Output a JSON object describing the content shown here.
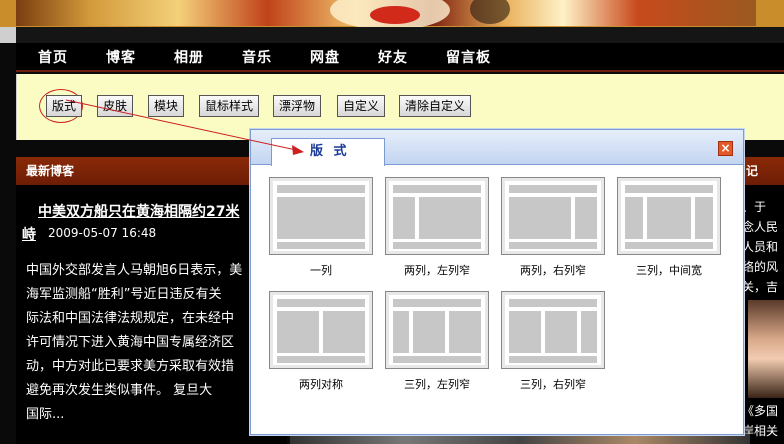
{
  "nav": {
    "items": [
      "首页",
      "博客",
      "相册",
      "音乐",
      "网盘",
      "好友",
      "留言板"
    ]
  },
  "toolbar": {
    "buttons": [
      "版式",
      "皮肤",
      "模块",
      "鼠标样式",
      "漂浮物",
      "自定义",
      "清除自定义"
    ]
  },
  "left_panel": {
    "heading": "最新博客",
    "post": {
      "title": "中美双方船只在黄海相隔约27米",
      "title_tail": "峙",
      "date": "2009-05-07 16:48",
      "body_lines": [
        "中国外交部发言人马朝旭6日表示，美",
        "海军监测船“胜利”号近日违反有关",
        "际法和中国法律法规规定，在未经中",
        "许可情况下进入黄海中国专属经济区",
        "动，中方对此已要求美方采取有效措",
        "避免再次发生类似事件。     复旦大",
        "国际..."
      ]
    }
  },
  "right_panel": {
    "heading": "记",
    "lines": [
      "、于",
      "念人民",
      "人员和",
      "络的风",
      "关，吉"
    ],
    "caption_lines": [
      "《多国",
      "岸相关"
    ]
  },
  "dialog": {
    "tab_label": "版 式",
    "close_symbol": "×",
    "layouts": [
      {
        "label": "一列"
      },
      {
        "label": "两列，左列窄"
      },
      {
        "label": "两列，右列窄"
      },
      {
        "label": "三列，中间宽"
      },
      {
        "label": "两列对称"
      },
      {
        "label": "三列，左列窄"
      },
      {
        "label": "三列，右列窄"
      }
    ]
  },
  "colors": {
    "toolbar_bg": "#fbfbc4",
    "panel_header": "#7a2306",
    "dialog_border": "#7a9cd3",
    "highlight_circle": "#cc2020",
    "dialog_title": "#1a3a9a"
  }
}
